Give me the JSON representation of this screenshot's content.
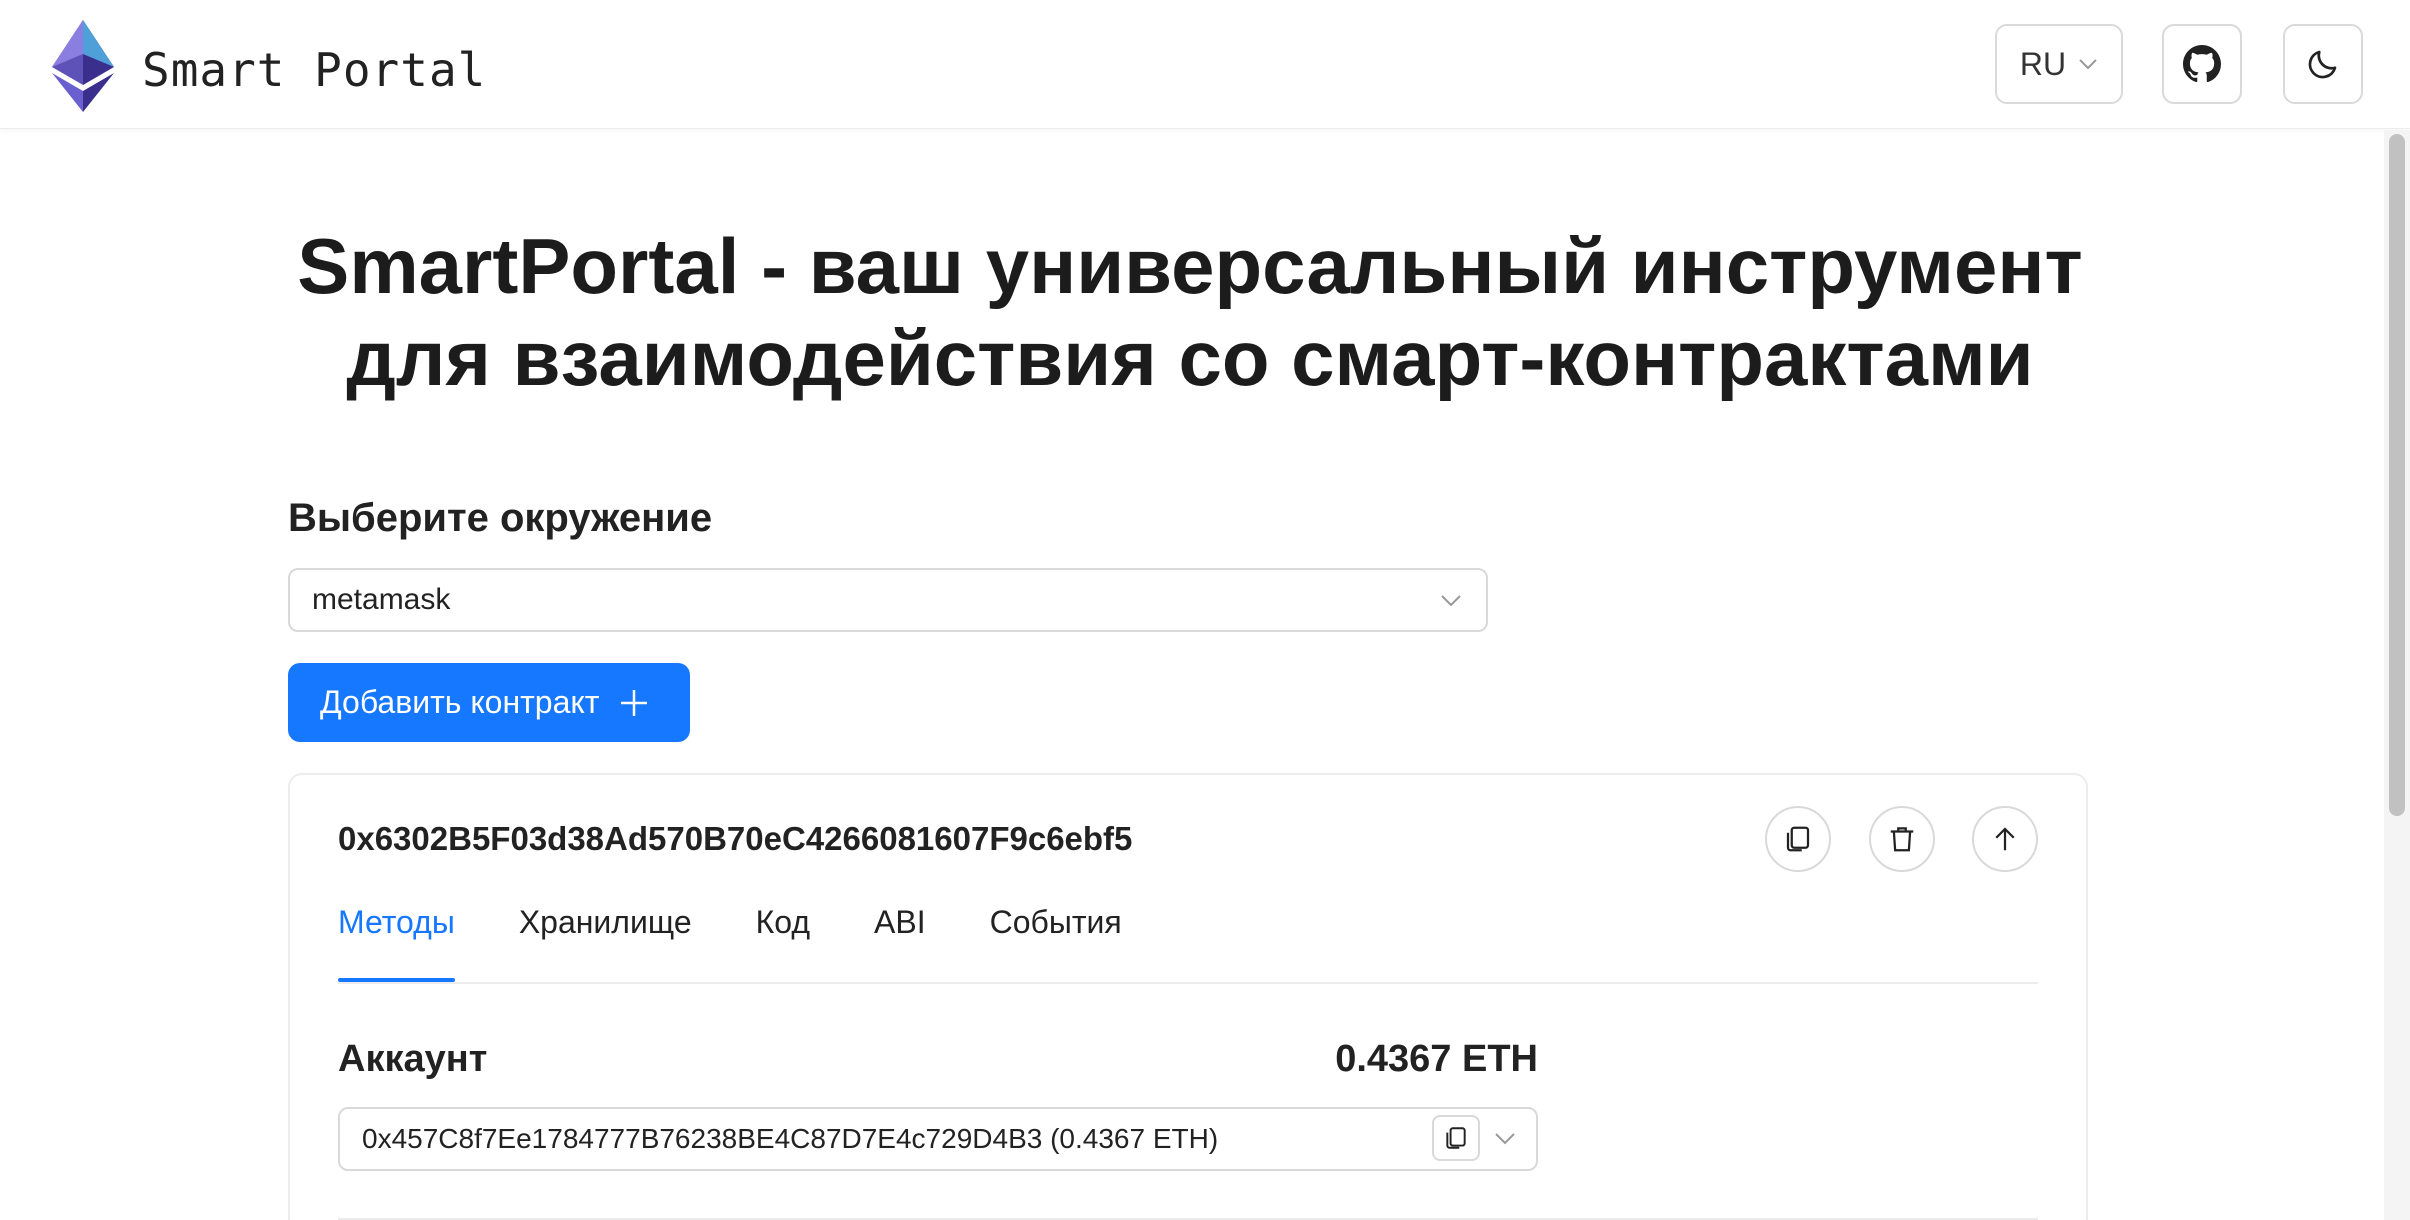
{
  "header": {
    "brand": "Smart Portal",
    "language": "RU",
    "icons": [
      "ethereum-logo-icon",
      "chevron-down-icon",
      "github-icon",
      "moon-icon"
    ]
  },
  "hero": {
    "title_line1": "SmartPortal - ваш универсальный инструмент",
    "title_line2": "для взаимодействия со смарт-контрактами"
  },
  "environment": {
    "label": "Выберите окружение",
    "selected": "metamask"
  },
  "add_contract": {
    "label": "Добавить контракт"
  },
  "contract": {
    "address": "0x6302B5F03d38Ad570B70eC4266081607F9c6ebf5",
    "tabs": [
      {
        "label": "Методы",
        "active": true
      },
      {
        "label": "Хранилище",
        "active": false
      },
      {
        "label": "Код",
        "active": false
      },
      {
        "label": "ABI",
        "active": false
      },
      {
        "label": "События",
        "active": false
      }
    ],
    "account": {
      "label": "Аккаунт",
      "balance": "0.4367 ETH",
      "selected": "0x457C8f7Ee1784777B76238BE4C87D7E4c729D4B3 (0.4367 ETH)"
    }
  },
  "colors": {
    "accent": "#1677ff",
    "border": "#d9d9d9",
    "text": "#1f1f1f"
  }
}
